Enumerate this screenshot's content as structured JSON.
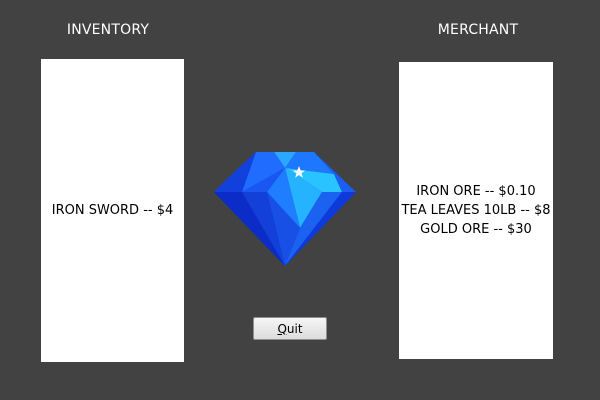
{
  "inventory": {
    "title": "INVENTORY",
    "items": [
      {
        "label": "IRON SWORD -- $4"
      }
    ]
  },
  "merchant": {
    "title": "MERCHANT",
    "items": [
      {
        "label": "IRON ORE -- $0.10"
      },
      {
        "label": "TEA LEAVES 10LB -- $8"
      },
      {
        "label": "GOLD ORE -- $30"
      }
    ]
  },
  "quit_button": {
    "mnemonic": "Q",
    "rest": "uit"
  },
  "gem": {
    "icon": "blue-diamond-icon",
    "colors": {
      "dark": "#0a2fd0",
      "mid": "#1f62ff",
      "light": "#27c0ff"
    }
  }
}
